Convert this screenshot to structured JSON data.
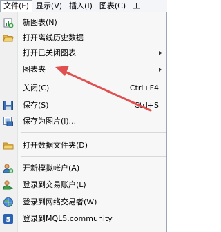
{
  "menubar": {
    "items": [
      {
        "label": "文件(F)"
      },
      {
        "label": "显示(V)"
      },
      {
        "label": "插入(I)"
      },
      {
        "label": "图表(C)"
      },
      {
        "label": "工"
      }
    ]
  },
  "file_menu": {
    "items": [
      {
        "label": "新图表(N)",
        "shortcut": "",
        "icon": "new-chart-icon"
      },
      {
        "label": "打开离线历史数据",
        "shortcut": "",
        "icon": "open-folder-icon"
      },
      {
        "label": "打开已关闭图表",
        "shortcut": "",
        "icon": ""
      },
      {
        "label": "图表夹",
        "shortcut": "",
        "icon": ""
      },
      {
        "label": "关闭(C)",
        "shortcut": "Ctrl+F4",
        "icon": ""
      },
      {
        "label": "保存(S)",
        "shortcut": "Ctrl+S",
        "icon": "save-icon"
      },
      {
        "label": "保存为图片(i)...",
        "shortcut": "",
        "icon": "save-picture-icon"
      },
      {
        "label": "打开数据文件夹(D)",
        "shortcut": "",
        "icon": "folder-icon"
      },
      {
        "label": "开新模拟帐户(A)",
        "shortcut": "",
        "icon": "demo-account-icon"
      },
      {
        "label": "登录到交易账户(L)",
        "shortcut": "",
        "icon": "trade-login-icon"
      },
      {
        "label": "登录到网络交易者(W)",
        "shortcut": "",
        "icon": "web-trader-icon"
      },
      {
        "label": "登录到MQL5.community",
        "shortcut": "",
        "icon": "mql5-icon"
      }
    ]
  },
  "colors": {
    "annotation_arrow": "#e05050",
    "highlight": "#e5eef9"
  }
}
